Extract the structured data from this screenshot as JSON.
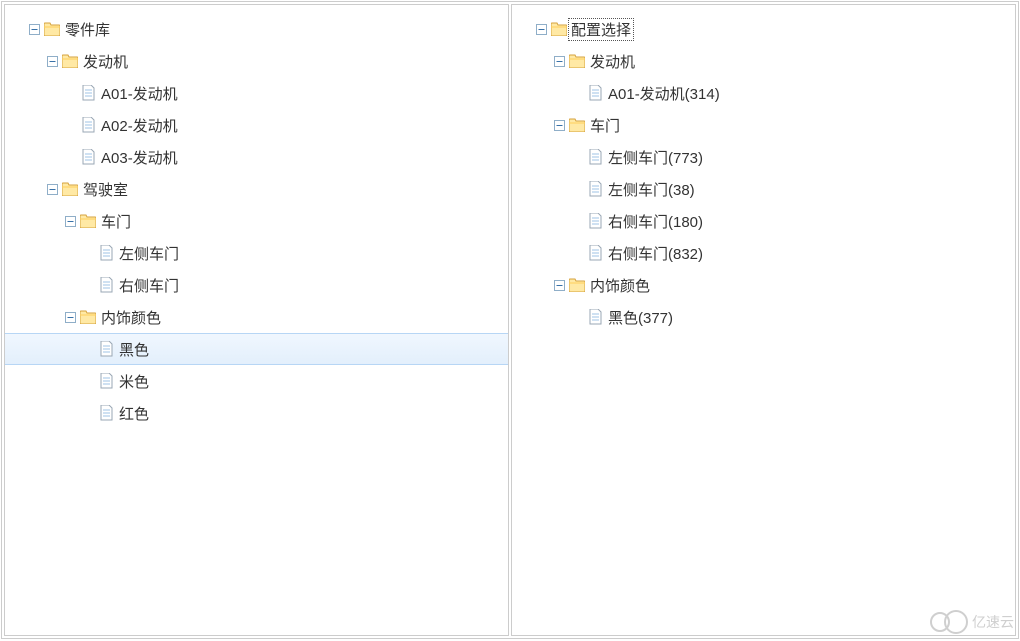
{
  "watermark": "亿速云",
  "leftTree": {
    "root": {
      "label": "零件库",
      "expanded": true,
      "type": "folder"
    },
    "children": [
      {
        "label": "发动机",
        "expanded": true,
        "type": "folder",
        "depth": 1,
        "children": [
          {
            "label": "A01-发动机",
            "type": "leaf",
            "depth": 2
          },
          {
            "label": "A02-发动机",
            "type": "leaf",
            "depth": 2
          },
          {
            "label": "A03-发动机",
            "type": "leaf",
            "depth": 2
          }
        ]
      },
      {
        "label": "驾驶室",
        "expanded": true,
        "type": "folder",
        "depth": 1,
        "children": [
          {
            "label": "车门",
            "expanded": true,
            "type": "folder",
            "depth": 2,
            "children": [
              {
                "label": "左侧车门",
                "type": "leaf",
                "depth": 3
              },
              {
                "label": "右侧车门",
                "type": "leaf",
                "depth": 3
              }
            ]
          },
          {
            "label": "内饰颜色",
            "expanded": true,
            "type": "folder",
            "depth": 2,
            "children": [
              {
                "label": "黑色",
                "type": "leaf",
                "depth": 3,
                "selected": true
              },
              {
                "label": "米色",
                "type": "leaf",
                "depth": 3
              },
              {
                "label": "红色",
                "type": "leaf",
                "depth": 3
              }
            ]
          }
        ]
      }
    ]
  },
  "rightTree": {
    "root": {
      "label": "配置选择",
      "expanded": true,
      "type": "folder",
      "focus": true
    },
    "children": [
      {
        "label": "发动机",
        "expanded": true,
        "type": "folder",
        "depth": 1,
        "children": [
          {
            "label": "A01-发动机(314)",
            "type": "leaf",
            "depth": 2
          }
        ]
      },
      {
        "label": "车门",
        "expanded": true,
        "type": "folder",
        "depth": 1,
        "children": [
          {
            "label": "左侧车门(773)",
            "type": "leaf",
            "depth": 2
          },
          {
            "label": "左侧车门(38)",
            "type": "leaf",
            "depth": 2
          },
          {
            "label": "右侧车门(180)",
            "type": "leaf",
            "depth": 2
          },
          {
            "label": "右侧车门(832)",
            "type": "leaf",
            "depth": 2
          }
        ]
      },
      {
        "label": "内饰颜色",
        "expanded": true,
        "type": "folder",
        "depth": 1,
        "children": [
          {
            "label": "黑色(377)",
            "type": "leaf",
            "depth": 2
          }
        ]
      }
    ]
  }
}
